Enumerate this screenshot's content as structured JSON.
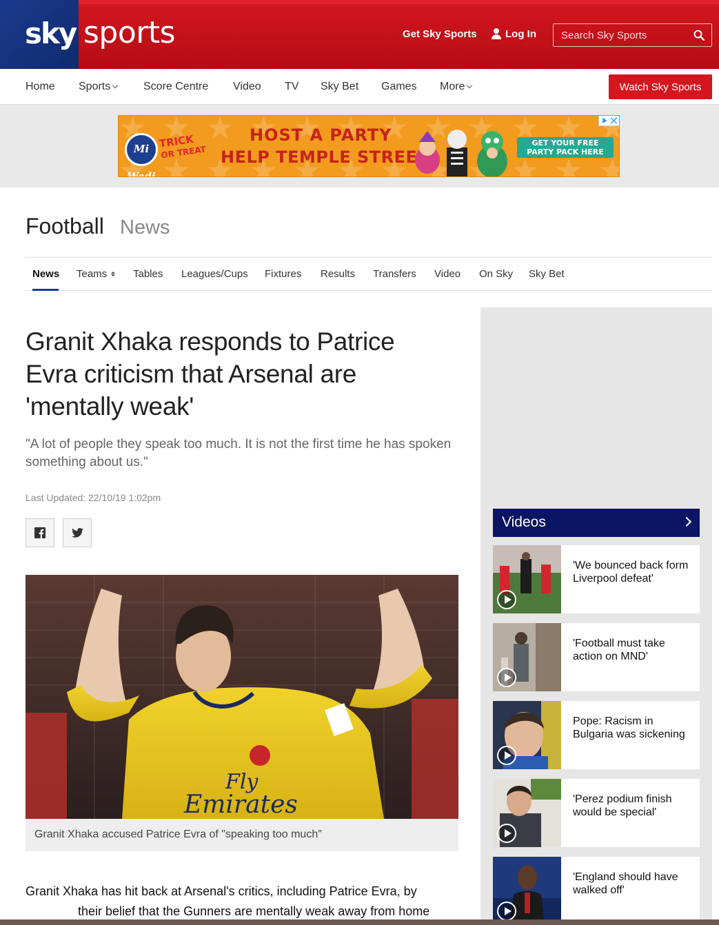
{
  "header": {
    "logo_sky": "sky",
    "logo_sports": "sports",
    "get_sky_sports": "Get Sky Sports",
    "login": "Log In",
    "search_placeholder": "Search Sky Sports",
    "brand_red": "#d4161f",
    "brand_blue": "#0f2a6e"
  },
  "nav": {
    "items": [
      "Home",
      "Sports",
      "Score Centre",
      "Video",
      "TV",
      "Sky Bet",
      "Games",
      "More"
    ],
    "watch_button": "Watch Sky Sports"
  },
  "ad": {
    "logo": "Mi Wadi",
    "trick": "TRICK",
    "or_treat": "OR TREAT",
    "headline_1": "HOST A PARTY",
    "headline_2": "HELP TEMPLE STREET",
    "cta_1": "GET YOUR FREE",
    "cta_2": "PARTY PACK HERE"
  },
  "section": {
    "title": "Football",
    "subtitle": "News",
    "tabs": [
      "News",
      "Teams",
      "Tables",
      "Leagues/Cups",
      "Fixtures",
      "Results",
      "Transfers",
      "Video",
      "On Sky",
      "Sky Bet"
    ],
    "active_tab": "News"
  },
  "article": {
    "headline": "Granit Xhaka responds to Patrice Evra criticism that Arsenal are 'mentally weak'",
    "standfirst": "\"A lot of people they speak too much. It is not the first time he has spoken something about us.\"",
    "updated": "Last Updated: 22/10/19 1:02pm",
    "caption": "Granit Xhaka accused Patrice Evra of \"speaking too much\"",
    "body_line_1": "Granit Xhaka has hit back at Arsenal's critics, including Patrice Evra, by",
    "body_line_2": "their belief that the Gunners are mentally weak away from home",
    "shirt_text_1": "Fly",
    "shirt_text_2": "Emirates"
  },
  "sidebar": {
    "videos_title": "Videos",
    "videos": [
      {
        "title": "'We bounced back form Liverpool defeat'"
      },
      {
        "title": "'Football must take action on MND'"
      },
      {
        "title": "Pope: Racism in Bulgaria was sickening"
      },
      {
        "title": "'Perez podium finish would be special'"
      },
      {
        "title": "'England should have walked off'"
      }
    ]
  }
}
